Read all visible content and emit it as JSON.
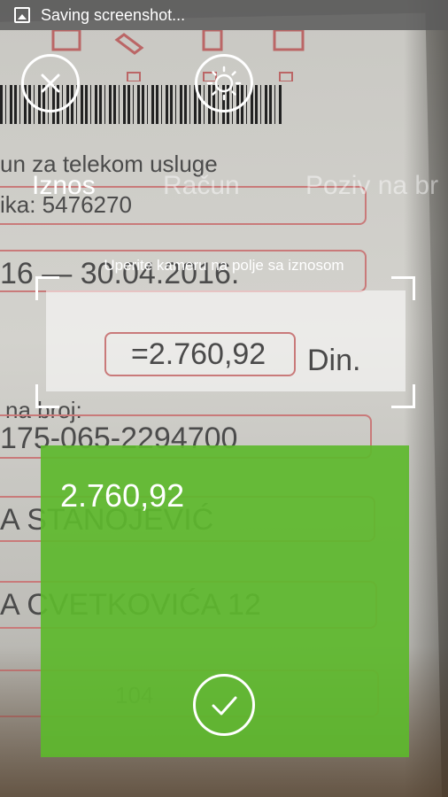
{
  "status_bar": {
    "text": "Saving screenshot..."
  },
  "camera_background": {
    "lines": [
      "un za telekom usluge",
      "ika: 5476270",
      "16 — 30.04.2016.",
      "na broj:",
      "175-065-2294700",
      "A STANOJEVIĆ",
      "A CVETKOVIĆA 12",
      "104"
    ]
  },
  "toolbar": {
    "close_icon": "close-icon",
    "flash_icon": "brightness-icon"
  },
  "tabs": [
    {
      "label": "Iznos",
      "active": true
    },
    {
      "label": "Račun",
      "active": false
    },
    {
      "label": "Poziv na br",
      "active": false
    }
  ],
  "scanner": {
    "hint": "Uperite kameru na polje sa iznosom",
    "recognized_text": "=2.760,92",
    "currency": "Din."
  },
  "result": {
    "value": "2.760,92",
    "confirm_icon": "check-icon",
    "color": "#5db92c"
  }
}
